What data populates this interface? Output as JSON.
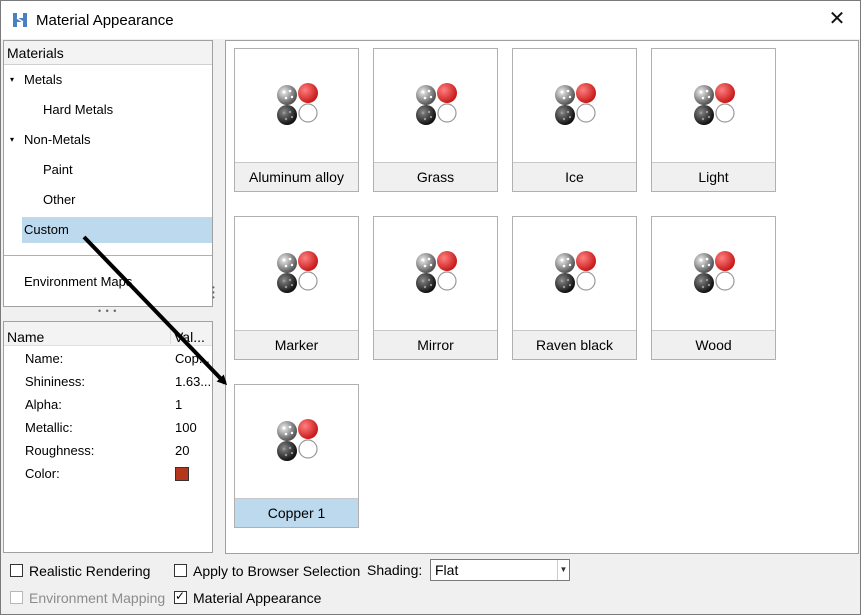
{
  "window": {
    "title": "Material Appearance",
    "close_glyph": "✕"
  },
  "tree": {
    "header": "Materials",
    "caret_glyph": "▾",
    "items": [
      {
        "label": "Metals",
        "level": 0,
        "expandable": true
      },
      {
        "label": "Hard Metals",
        "level": 1
      },
      {
        "label": "Non-Metals",
        "level": 0,
        "expandable": true
      },
      {
        "label": "Paint",
        "level": 1
      },
      {
        "label": "Other",
        "level": 1
      },
      {
        "label": "Custom",
        "level": 0,
        "selected": true
      }
    ],
    "environment_maps": "Environment Maps"
  },
  "splitter": {
    "dots": "• • •"
  },
  "properties": {
    "col_name": "Name",
    "col_value": "Val...",
    "rows": [
      {
        "name": "Name:",
        "value": "Cop..."
      },
      {
        "name": "Shininess:",
        "value": "1.63..."
      },
      {
        "name": "Alpha:",
        "value": "1"
      },
      {
        "name": "Metallic:",
        "value": "100"
      },
      {
        "name": "Roughness:",
        "value": "20"
      },
      {
        "name": "Color:",
        "value": ""
      }
    ],
    "color_swatch": "#b5371b"
  },
  "materials": [
    {
      "label": "Aluminum alloy"
    },
    {
      "label": "Grass"
    },
    {
      "label": "Ice"
    },
    {
      "label": "Light"
    },
    {
      "label": "Marker"
    },
    {
      "label": "Mirror"
    },
    {
      "label": "Raven black"
    },
    {
      "label": "Wood"
    },
    {
      "label": "Copper 1",
      "selected": true
    }
  ],
  "options": {
    "realistic_rendering": {
      "label": "Realistic Rendering",
      "checked": false
    },
    "apply_browser": {
      "label": "Apply to Browser Selection",
      "checked": false
    },
    "shading_label": "Shading:",
    "shading_value": "Flat",
    "environment_mapping": {
      "label": "Environment Mapping",
      "checked": false,
      "disabled": true
    },
    "material_appearance": {
      "label": "Material Appearance",
      "checked": true
    }
  },
  "colors": {
    "selection": "#bcd9ee",
    "sphere_red": "#c81a1a"
  }
}
